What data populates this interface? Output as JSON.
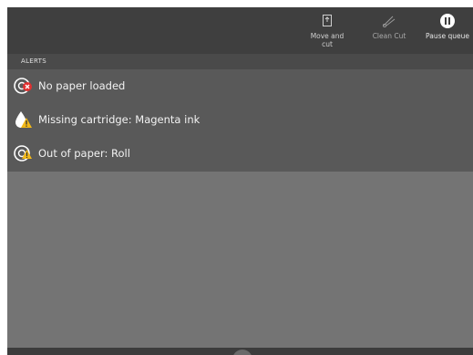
{
  "toolbar": {
    "move_and_cut": {
      "label": "Move and\ncut",
      "icon": "move-and-cut-icon",
      "enabled": true
    },
    "clean_cut": {
      "label": "Clean Cut",
      "icon": "clean-cut-icon",
      "enabled": false
    },
    "pause_queue": {
      "label": "Pause queue",
      "icon": "pause-icon",
      "enabled": true
    }
  },
  "alerts": {
    "header": "ALERTS",
    "items": [
      {
        "text": "No paper loaded",
        "icon": "error-paper-icon",
        "severity": "error"
      },
      {
        "text": "Missing cartridge: Magenta ink",
        "icon": "ink-warning-icon",
        "severity": "warning"
      },
      {
        "text": "Out of paper: Roll",
        "icon": "roll-warning-icon",
        "severity": "warning"
      }
    ]
  },
  "colors": {
    "toolbar_bg": "#3f3f3f",
    "header_bg": "#4a4a4a",
    "list_bg": "#595959",
    "empty_bg": "#747474",
    "error": "#e03030",
    "warning": "#f2b818"
  }
}
